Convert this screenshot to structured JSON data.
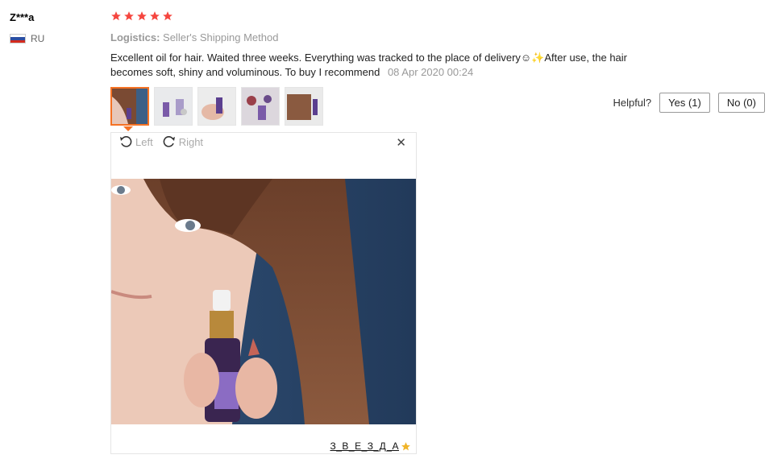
{
  "review": {
    "username": "Z***a",
    "country": "RU",
    "rating": 5,
    "logistics_label": "Logistics:",
    "logistics_value": "Seller's Shipping Method",
    "text_line1": "Excellent oil for hair. Waited three weeks. Everything was tracked to the place of delivery☺✨After use, the hair",
    "text_line2": "becomes soft, shiny and voluminous. To buy I recommend",
    "date": "08 Apr 2020 00:24"
  },
  "helpful": {
    "label": "Helpful?",
    "yes": "Yes (1)",
    "no": "No (0)"
  },
  "viewer": {
    "left_label": "Left",
    "right_label": "Right",
    "close_symbol": "✕",
    "watermark": "З_В_Е_З_Д_А"
  },
  "colors": {
    "star": "#f5463f",
    "accent": "#f57224",
    "flag_white": "#ffffff",
    "flag_blue": "#2a4ea3",
    "flag_red": "#d52b1e"
  },
  "icons": {
    "rotate_left": "rotate-left-icon",
    "rotate_right": "rotate-right-icon",
    "close": "close-icon",
    "star": "star-icon"
  }
}
